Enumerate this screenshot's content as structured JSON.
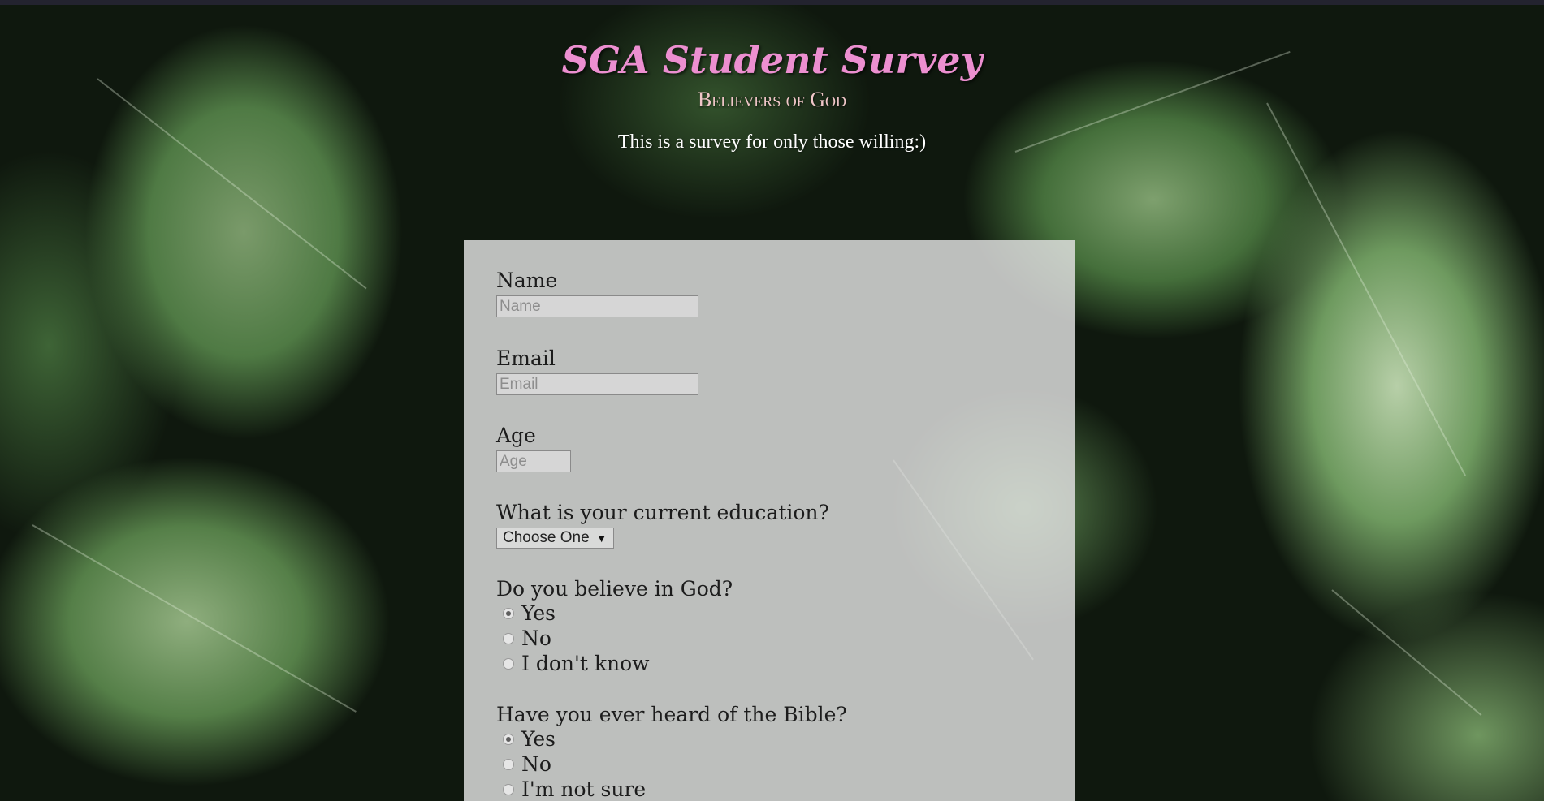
{
  "header": {
    "title": "SGA Student Survey",
    "subtitle": "Believers of God",
    "description": "This is a survey for only those willing:)"
  },
  "form": {
    "name": {
      "label": "Name",
      "placeholder": "Name"
    },
    "email": {
      "label": "Email",
      "placeholder": "Email"
    },
    "age": {
      "label": "Age",
      "placeholder": "Age"
    },
    "education": {
      "label": "What is your current education?",
      "selected": "Choose One"
    },
    "believe": {
      "label": "Do you believe in God?",
      "options": [
        "Yes",
        "No",
        "I don't know"
      ],
      "selected": "Yes"
    },
    "bible": {
      "label": "Have you ever heard of the Bible?",
      "options": [
        "Yes",
        "No",
        "I'm not sure"
      ],
      "selected": "Yes"
    }
  },
  "colors": {
    "title": "#ec8fd0",
    "subtitle": "#f1c7c9",
    "panel": "#e1e1e1"
  }
}
